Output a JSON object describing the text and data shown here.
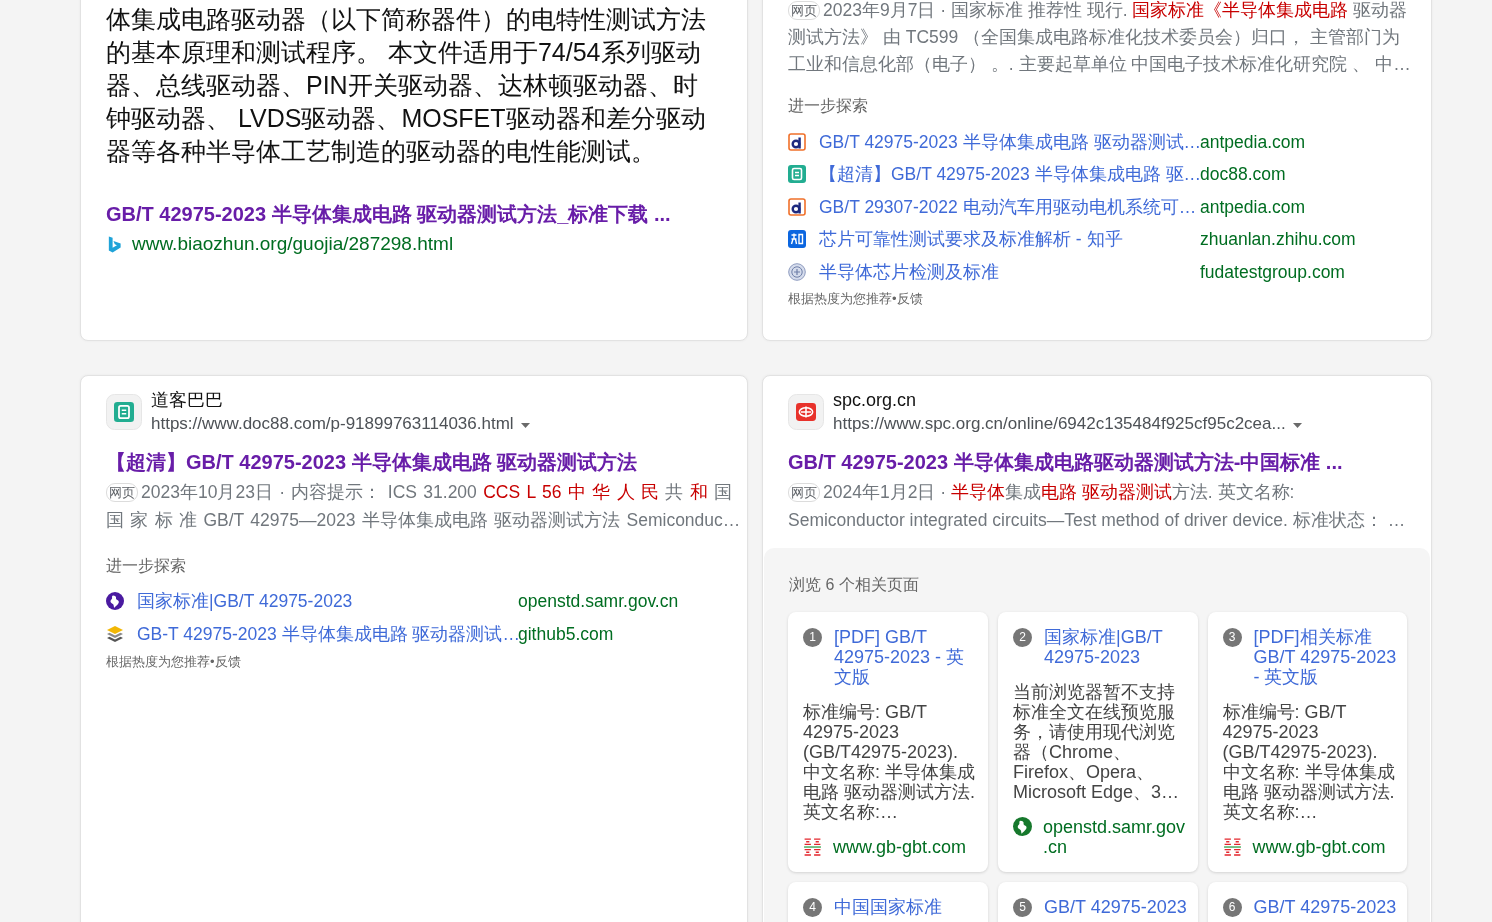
{
  "cards": [
    {
      "body": "体集成电路驱动器（以下简称器件）的电特性测试方法的基本原理和测试程序。 本文件适用于74/54系列驱动器、总线驱动器、PIN开关驱动器、达林顿驱动器、时钟驱动器、 LVDS驱动器、MOSFET驱动器和差分驱动器等各种半导体工艺制造的驱动器的电性能测试。",
      "title": "GB/T 42975-2023 半导体集成电路 驱动器测试方法_标准下载 ...",
      "source": {
        "kind": "swoosh",
        "url": "www.biaozhun.org/guojia/287298.html"
      }
    },
    {
      "snippet": {
        "badge": "网页",
        "segments": [
          {
            "text": "2023年9月7日 · 国家标准 推荐性 现行. ",
            "highlight": false
          },
          {
            "text": "国家标准《半导体集成电路",
            "highlight": true
          },
          {
            "text": " 驱动器测试方法》 由 TC599 （全国集成电路标准化技术委员会）归口， 主管部门为工业和信息化部（电子） 。. 主要起草单位 中国电子技术标准化研究院 、 中…",
            "highlight": false
          }
        ]
      },
      "explore": {
        "heading": "进一步探索",
        "items": [
          {
            "kind": "ring",
            "title": "GB/T 42975-2023 半导体集成电路 驱动器测试…",
            "domain": "antpedia.com"
          },
          {
            "kind": "frame",
            "title": "【超清】GB/T 42975-2023 半导体集成电路 驱…",
            "domain": "doc88.com"
          },
          {
            "kind": "ring",
            "title": "GB/T 29307-2022 电动汽车用驱动电机系统可…",
            "domain": "antpedia.com"
          },
          {
            "kind": "square",
            "title": "芯片可靠性测试要求及标准解析 - 知乎",
            "domain": "zhuanlan.zhihu.com"
          },
          {
            "kind": "seal",
            "title": "半导体芯片检测及标准",
            "domain": "fudatestgroup.com"
          }
        ],
        "footer": "根据热度为您推荐•反馈"
      }
    },
    {
      "site": {
        "kind": "frame",
        "name": "道客巴巴",
        "url": "https://www.doc88.com/p-91899763114036.html"
      },
      "title": "【超清】GB/T 42975-2023 半导体集成电路 驱动器测试方法",
      "snippet": {
        "badge": "网页",
        "segments": [
          {
            "text": "2023年10月23日 · 内容提示： ICS 31.200 ",
            "highlight": false
          },
          {
            "text": "CCS L 56 中 华 人 民",
            "highlight": true
          },
          {
            "text": " 共 ",
            "highlight": false
          },
          {
            "text": "和",
            "highlight": true
          },
          {
            "text": " 国国 家 标 准 GB/T 42975—2023 半导体集成电路 驱动器测试方法 Semiconduc…",
            "highlight": false
          }
        ]
      },
      "explore": {
        "heading": "进一步探索",
        "items": [
          {
            "kind": "globe",
            "title": "国家标准|GB/T 42975-2023",
            "domain": "openstd.samr.gov.cn"
          },
          {
            "kind": "layers",
            "title": "GB-T 42975-2023 半导体集成电路 驱动器测试…",
            "domain": "github5.com"
          }
        ],
        "footer": "根据热度为您推荐•反馈"
      }
    },
    {
      "site": {
        "kind": "emblem",
        "name": "spc.org.cn",
        "url": "https://www.spc.org.cn/online/6942c135484f925cf95c2cea..."
      },
      "title": "GB/T 42975-2023 半导体集成电路驱动器测试方法-中国标准 ...",
      "snippet": {
        "badge": "网页",
        "segments": [
          {
            "text": "2024年1月2日 · ",
            "highlight": false
          },
          {
            "text": "半导体",
            "highlight": true
          },
          {
            "text": "集成",
            "highlight": false
          },
          {
            "text": "电路 驱动器测试",
            "highlight": true
          },
          {
            "text": "方法. 英文名称: Semiconductor integrated circuits—Test method of driver device. 标准状态： …",
            "highlight": false
          }
        ]
      },
      "related": {
        "heading": "浏览 6 个相关页面",
        "pages": [
          {
            "number": "1",
            "title": "[PDF] GB/T 42975-2023 - 英文版",
            "body": "标准编号: GB/T 42975-2023 (GB/T42975-2023). 中文名称: 半导体集成电路 驱动器测试方法. 英文名称:…",
            "source": {
              "kind": "stripes",
              "domain": "www.gb-gbt.com"
            }
          },
          {
            "number": "2",
            "title": "国家标准|GB/T 42975-2023",
            "body": "当前浏览器暂不支持标准全文在线预览服务，请使用现代浏览器（Chrome、Firefox、Opera、Microsoft Edge、3…",
            "source": {
              "kind": "globe",
              "domain": "openstd.samr.gov.cn"
            }
          },
          {
            "number": "3",
            "title": "[PDF]相关标准 GB/T 42975-2023 - 英文版",
            "body": "标准编号: GB/T 42975-2023 (GB/T42975-2023). 中文名称: 半导体集成电路 驱动器测试方法. 英文名称:…",
            "source": {
              "kind": "stripes",
              "domain": "www.gb-gbt.com"
            }
          },
          {
            "number": "4",
            "title": "中国国家标准"
          },
          {
            "number": "5",
            "title": "GB/T 42975-2023"
          },
          {
            "number": "6",
            "title": "GB/T 42975-2023"
          }
        ]
      }
    }
  ]
}
